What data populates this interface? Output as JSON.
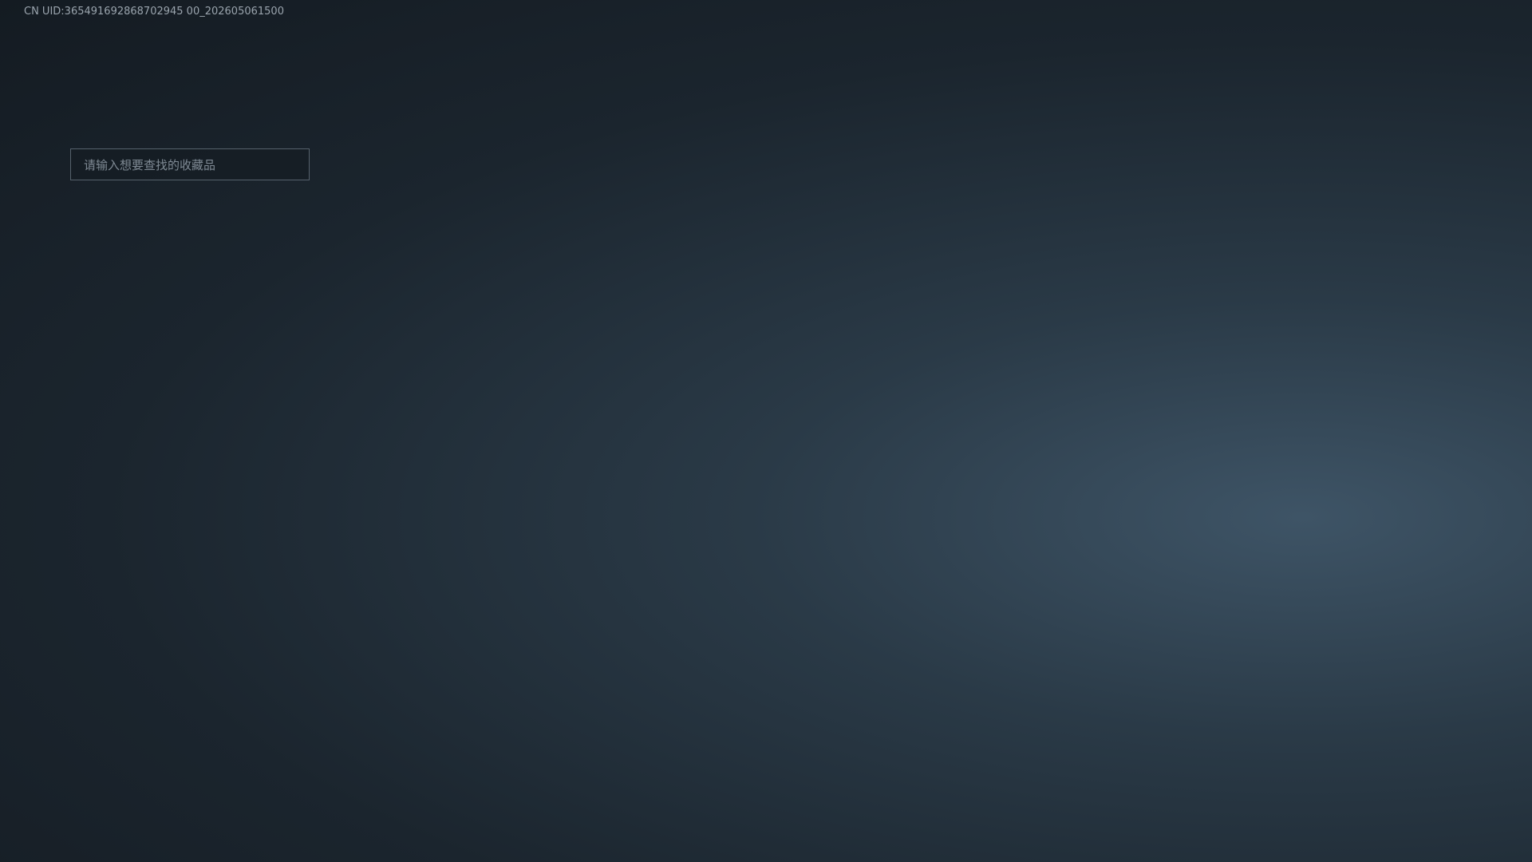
{
  "header": {
    "uid": "CN UID:365491692868702945 00_202605061500"
  },
  "search": {
    "placeholder": "请输入想要查找的收藏品"
  }
}
